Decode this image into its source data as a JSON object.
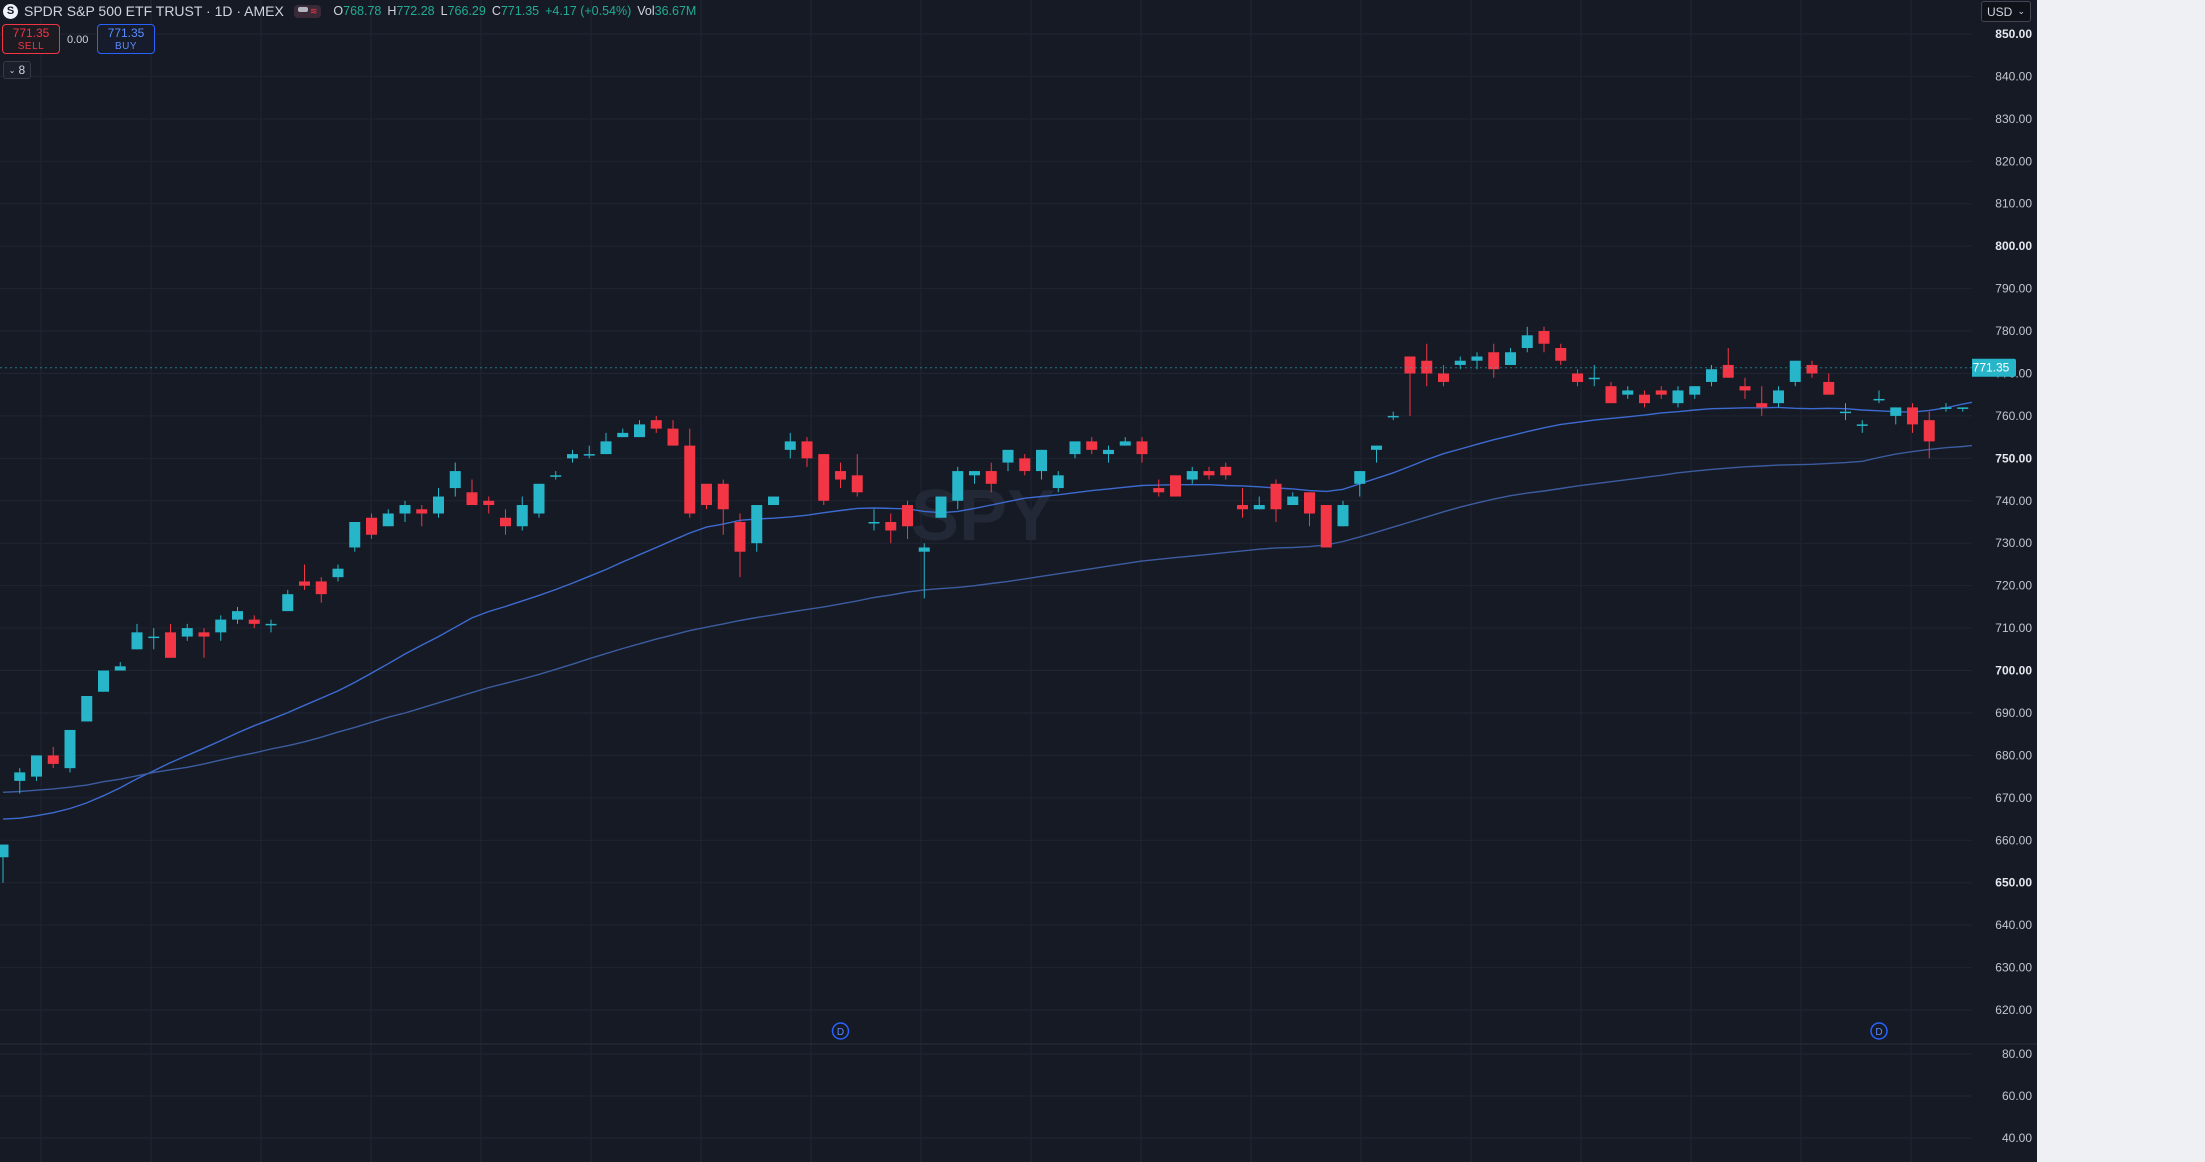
{
  "header": {
    "logo_letter": "S",
    "title": "SPDR S&P 500 ETF TRUST · 1D · AMEX",
    "open_label": "O",
    "open": "768.78",
    "high_label": "H",
    "high": "772.28",
    "low_label": "L",
    "low": "766.29",
    "close_label": "C",
    "close": "771.35",
    "change": "+4.17 (+0.54%)",
    "vol_label": "Vol",
    "vol": "36.67M"
  },
  "trade": {
    "sell_price": "771.35",
    "sell_label": "SELL",
    "spread": "0.00",
    "buy_price": "771.35",
    "buy_label": "BUY"
  },
  "indicators_toggle": {
    "count": "8"
  },
  "currency": "USD",
  "watermark": "SPY",
  "colors": {
    "background": "#161a25",
    "up": "#26b5c9",
    "down": "#f23645",
    "ma_fast": "#3d6bd1",
    "ma_slow": "#3c5ca0",
    "grid": "#202533",
    "axis_text": "#c3c6ce",
    "current_price": "#26b5c9",
    "gutter": "#eef0f3"
  },
  "price_axis": {
    "min": 612,
    "max": 858,
    "ticks": [
      "620.00",
      "630.00",
      "640.00",
      "650.00",
      "660.00",
      "670.00",
      "680.00",
      "690.00",
      "700.00",
      "710.00",
      "720.00",
      "730.00",
      "740.00",
      "750.00",
      "760.00",
      "770.00",
      "780.00",
      "790.00",
      "800.00",
      "810.00",
      "820.00",
      "830.00",
      "840.00",
      "850.00"
    ],
    "bold_ticks": [
      "650.00",
      "700.00",
      "750.00",
      "800.00",
      "850.00"
    ],
    "current_price": "771.35"
  },
  "lower_axis": {
    "ticks": [
      "80.00",
      "60.00",
      "40.00"
    ]
  },
  "chart_data": {
    "type": "candlestick",
    "series": [
      {
        "name": "",
        "type": "candlestick",
        "values": [
          [
            656,
            659,
            650,
            659
          ],
          [
            674,
            677,
            671,
            676
          ],
          [
            675,
            680,
            674,
            680
          ],
          [
            680,
            682,
            677,
            678
          ],
          [
            677,
            686,
            676,
            686
          ],
          [
            688,
            694,
            688,
            694
          ],
          [
            695,
            700,
            695,
            700
          ],
          [
            700,
            702,
            700,
            701
          ],
          [
            705,
            711,
            705,
            709
          ],
          [
            708,
            710,
            705,
            708
          ],
          [
            709,
            711,
            703,
            703
          ],
          [
            708,
            711,
            707,
            710
          ],
          [
            709,
            710,
            703,
            708
          ],
          [
            709,
            713,
            707,
            712
          ],
          [
            712,
            715,
            711,
            714
          ],
          [
            712,
            713,
            710,
            711
          ],
          [
            711,
            712,
            709,
            711
          ],
          [
            714,
            719,
            714,
            718
          ],
          [
            721,
            725,
            719,
            720
          ],
          [
            721,
            722,
            716,
            718
          ],
          [
            722,
            725,
            721,
            724
          ],
          [
            729,
            735,
            728,
            735
          ],
          [
            736,
            737,
            731,
            732
          ],
          [
            734,
            738,
            734,
            737
          ],
          [
            737,
            740,
            735,
            739
          ],
          [
            738,
            739,
            734,
            737
          ],
          [
            737,
            743,
            736,
            741
          ],
          [
            743,
            749,
            741,
            747
          ],
          [
            742,
            745,
            739,
            739
          ],
          [
            740,
            741,
            737,
            739
          ],
          [
            736,
            738,
            732,
            734
          ],
          [
            734,
            741,
            733,
            739
          ],
          [
            737,
            744,
            736,
            744
          ],
          [
            746,
            747,
            745,
            746
          ],
          [
            750,
            752,
            749,
            751
          ],
          [
            751,
            753,
            750,
            751
          ],
          [
            751,
            756,
            751,
            754
          ],
          [
            755,
            757,
            755,
            756
          ],
          [
            755,
            759,
            755,
            758
          ],
          [
            759,
            760,
            756,
            757
          ],
          [
            757,
            759,
            753,
            753
          ],
          [
            753,
            757,
            736,
            737
          ],
          [
            744,
            744,
            738,
            739
          ],
          [
            744,
            745,
            732,
            738
          ],
          [
            735,
            737,
            722,
            728
          ],
          [
            730,
            739,
            728,
            739
          ],
          [
            739,
            741,
            739,
            741
          ],
          [
            752,
            756,
            750,
            754
          ],
          [
            754,
            755,
            748,
            750
          ],
          [
            751,
            751,
            739,
            740
          ],
          [
            747,
            749,
            743,
            745
          ],
          [
            746,
            751,
            741,
            742
          ],
          [
            735,
            738,
            733,
            735
          ],
          [
            735,
            737,
            730,
            733
          ],
          [
            739,
            740,
            731,
            734
          ],
          [
            728,
            730,
            717,
            729
          ],
          [
            736,
            741,
            736,
            741
          ],
          [
            740,
            748,
            738,
            747
          ],
          [
            746,
            747,
            744,
            747
          ],
          [
            747,
            749,
            742,
            744
          ],
          [
            749,
            752,
            747,
            752
          ],
          [
            750,
            751,
            746,
            747
          ],
          [
            747,
            752,
            745,
            752
          ],
          [
            743,
            747,
            742,
            746
          ],
          [
            751,
            754,
            750,
            754
          ],
          [
            754,
            755,
            751,
            752
          ],
          [
            751,
            753,
            749,
            752
          ],
          [
            753,
            755,
            753,
            754
          ],
          [
            754,
            755,
            749,
            751
          ],
          [
            743,
            745,
            741,
            742
          ],
          [
            746,
            746,
            741,
            741
          ],
          [
            745,
            748,
            744,
            747
          ],
          [
            747,
            748,
            745,
            746
          ],
          [
            748,
            749,
            745,
            746
          ],
          [
            739,
            743,
            736,
            738
          ],
          [
            738,
            741,
            738,
            739
          ],
          [
            744,
            745,
            735,
            738
          ],
          [
            739,
            742,
            739,
            741
          ],
          [
            742,
            742,
            734,
            737
          ],
          [
            739,
            739,
            729,
            729
          ],
          [
            734,
            740,
            734,
            739
          ],
          [
            744,
            747,
            741,
            747
          ],
          [
            752,
            753,
            749,
            753
          ],
          [
            760,
            761,
            759,
            760
          ],
          [
            774,
            774,
            760,
            770
          ],
          [
            773,
            777,
            767,
            770
          ],
          [
            770,
            772,
            767,
            768
          ],
          [
            772,
            774,
            771,
            773
          ],
          [
            773,
            775,
            771,
            774
          ],
          [
            775,
            777,
            769,
            771
          ],
          [
            772,
            776,
            772,
            775
          ],
          [
            776,
            781,
            775,
            779
          ],
          [
            780,
            781,
            775,
            777
          ],
          [
            776,
            777,
            772,
            773
          ],
          [
            770,
            771,
            767,
            768
          ],
          [
            769,
            772,
            767,
            769
          ],
          [
            767,
            768,
            763,
            763
          ],
          [
            765,
            767,
            764,
            766
          ],
          [
            765,
            766,
            762,
            763
          ],
          [
            766,
            767,
            764,
            765
          ],
          [
            763,
            767,
            762,
            766
          ],
          [
            765,
            767,
            764,
            767
          ],
          [
            768,
            772,
            767,
            771
          ],
          [
            772,
            776,
            769,
            769
          ],
          [
            767,
            769,
            764,
            766
          ],
          [
            763,
            767,
            760,
            762
          ],
          [
            763,
            767,
            762,
            766
          ],
          [
            768,
            773,
            767,
            773
          ],
          [
            772,
            773,
            769,
            770
          ],
          [
            768,
            770,
            765,
            765
          ],
          [
            761,
            763,
            759,
            761
          ],
          [
            758,
            759,
            756,
            758
          ],
          [
            764,
            766,
            763,
            764
          ],
          [
            760,
            762,
            758,
            762
          ],
          [
            762,
            763,
            756,
            758
          ],
          [
            759,
            761,
            750,
            754
          ],
          [
            762,
            763,
            761,
            762
          ],
          [
            762,
            762,
            761,
            762
          ],
          [
            765,
            766,
            761,
            763
          ],
          [
            774,
            776,
            766,
            767
          ],
          [
            773,
            774,
            772,
            774
          ],
          [
            771,
            771,
            765,
            766
          ],
          [
            764,
            768,
            763,
            767
          ],
          [
            770,
            773,
            769,
            771
          ]
        ]
      },
      {
        "name": "",
        "type": "line",
        "values": [
          665.0,
          665.2,
          665.8,
          666.5,
          667.5,
          668.8,
          670.5,
          672.4,
          674.5,
          676.4,
          678.3,
          680.0,
          681.7,
          683.5,
          685.3,
          687.0,
          688.5,
          690.1,
          691.8,
          693.5,
          695.2,
          697.2,
          699.4,
          701.6,
          703.9,
          706.0,
          708.0,
          710.2,
          712.4,
          713.9,
          715.1,
          716.4,
          717.7,
          719.1,
          720.6,
          722.2,
          723.8,
          725.6,
          727.3,
          729.0,
          730.7,
          732.4,
          733.8,
          734.5,
          735.4,
          735.7,
          735.9,
          736.2,
          736.6,
          737.2,
          737.7,
          738.2,
          738.3,
          738.2,
          738.1,
          737.5,
          737.2,
          737.5,
          738.2,
          739.0,
          739.8,
          740.6,
          741.0,
          741.4,
          741.9,
          742.4,
          742.8,
          743.2,
          743.6,
          743.7,
          743.8,
          743.8,
          743.8,
          743.6,
          743.5,
          743.3,
          743.0,
          742.8,
          742.4,
          742.2,
          742.7,
          744.0,
          745.3,
          746.6,
          748.1,
          749.7,
          751.1,
          752.2,
          753.3,
          754.4,
          755.3,
          756.3,
          757.2,
          758.0,
          758.5,
          759.0,
          759.4,
          759.8,
          760.2,
          760.7,
          761.0,
          761.4,
          761.7,
          761.8,
          761.9,
          761.9,
          762.0,
          761.8,
          761.7,
          761.8,
          761.7,
          761.4,
          761.2,
          761.0,
          760.9,
          761.3,
          761.9,
          762.8,
          763.5,
          763.9,
          764.2,
          764.6
        ]
      },
      {
        "name": "",
        "type": "line",
        "values": [
          671.3,
          671.5,
          671.8,
          672.1,
          672.5,
          673.0,
          673.8,
          674.4,
          675.2,
          676.0,
          676.6,
          677.2,
          678.0,
          678.9,
          679.8,
          680.6,
          681.5,
          682.3,
          683.2,
          684.3,
          685.5,
          686.6,
          687.8,
          689.0,
          690.0,
          691.2,
          692.4,
          693.6,
          694.8,
          696.0,
          697.0,
          698.0,
          699.1,
          700.3,
          701.5,
          702.8,
          704.0,
          705.2,
          706.3,
          707.4,
          708.4,
          709.4,
          710.2,
          711.0,
          711.8,
          712.5,
          713.1,
          713.8,
          714.4,
          715.0,
          715.7,
          716.4,
          717.2,
          717.8,
          718.5,
          719.0,
          719.3,
          719.6,
          720.0,
          720.5,
          721.0,
          721.6,
          722.2,
          722.8,
          723.4,
          724.0,
          724.6,
          725.2,
          725.8,
          726.2,
          726.6,
          727.0,
          727.4,
          727.8,
          728.2,
          728.6,
          728.9,
          729.0,
          729.2,
          729.6,
          730.4,
          731.5,
          732.6,
          733.8,
          735.0,
          736.2,
          737.4,
          738.5,
          739.5,
          740.4,
          741.2,
          741.8,
          742.3,
          742.9,
          743.5,
          744.0,
          744.5,
          745.0,
          745.5,
          746.0,
          746.6,
          747.0,
          747.4,
          747.7,
          748.0,
          748.2,
          748.4,
          748.5,
          748.6,
          748.8,
          749.0,
          749.3,
          750.2,
          751.0,
          751.6,
          752.1,
          752.5,
          752.8,
          753.2,
          753.5,
          753.8,
          754.1
        ]
      }
    ],
    "ylim": [
      612,
      858
    ],
    "event_markers": [
      {
        "label": "D",
        "index": 50
      },
      {
        "label": "D",
        "index": 112
      }
    ]
  }
}
